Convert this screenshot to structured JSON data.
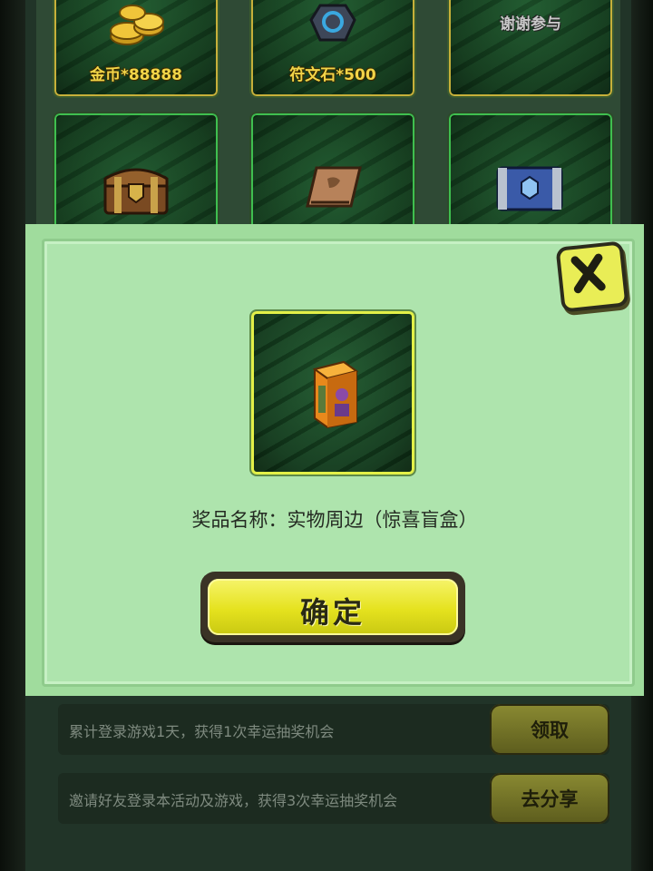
{
  "prize_grid": {
    "items": [
      {
        "label": "金币*88888",
        "icon": "gold-coins-icon"
      },
      {
        "label": "符文石*500",
        "icon": "rune-stone-icon"
      },
      {
        "label": "谢谢参与",
        "icon": ""
      },
      {
        "label": "",
        "icon": "wooden-chest-icon"
      },
      {
        "label": "",
        "icon": "scroll-icon"
      },
      {
        "label": "",
        "icon": "blue-chest-icon"
      }
    ]
  },
  "prize_dialog": {
    "close_icon": "close-x-icon",
    "prize_icon": "blind-box-icon",
    "prize_name": "奖品名称：实物周边（惊喜盲盒）",
    "confirm_label": "确定"
  },
  "tasks": [
    {
      "text": "累计登录游戏1天，获得1次幸运抽奖机会",
      "button": "领取"
    },
    {
      "text": "邀请好友登录本活动及游戏，获得3次幸运抽奖机会",
      "button": "去分享"
    }
  ],
  "colors": {
    "overlay_bg": "#a0dc9d",
    "accent_yellow": "#e5e21e",
    "tile_border_gold": "#c7b03a",
    "tile_border_green": "#3fbf4f"
  }
}
